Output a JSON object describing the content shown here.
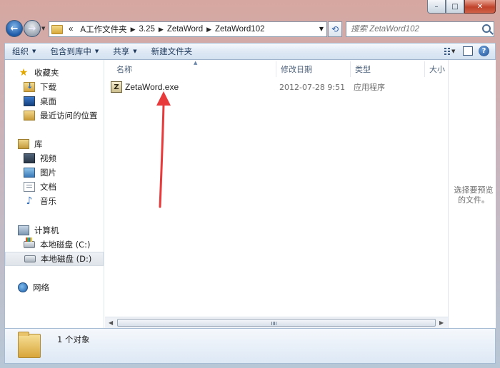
{
  "address": {
    "crumbs": [
      "«",
      "A工作文件夹",
      "3.25",
      "ZetaWord",
      "ZetaWord102"
    ]
  },
  "search": {
    "placeholder": "搜索 ZetaWord102"
  },
  "toolbar": {
    "organize": "组织",
    "include_in_library": "包含到库中",
    "share": "共享",
    "new_folder": "新建文件夹"
  },
  "nav": {
    "favorites": "收藏夹",
    "downloads": "下载",
    "desktop": "桌面",
    "recent": "最近访问的位置",
    "libraries": "库",
    "videos": "视频",
    "pictures": "图片",
    "documents": "文档",
    "music": "音乐",
    "computer": "计算机",
    "drive_c": "本地磁盘 (C:)",
    "drive_d": "本地磁盘 (D:)",
    "network": "网络"
  },
  "columns": {
    "name": "名称",
    "date": "修改日期",
    "type": "类型",
    "size": "大小"
  },
  "files": [
    {
      "name": "ZetaWord.exe",
      "date": "2012-07-28 9:51",
      "type": "应用程序"
    }
  ],
  "preview": {
    "message": "选择要预览的文件。"
  },
  "details": {
    "count": "1 个对象"
  },
  "colors": {
    "annotation_arrow": "#e8393b"
  }
}
